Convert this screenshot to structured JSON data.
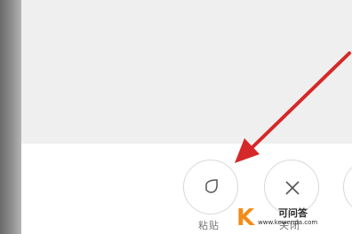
{
  "actions": {
    "paste": {
      "label": "粘贴",
      "icon": "paste-icon"
    },
    "close": {
      "label": "关闭",
      "icon": "close-icon"
    },
    "more": {
      "icon": "more-action-icon"
    }
  },
  "annotation": {
    "arrow_color": "#d62828"
  },
  "watermark": {
    "logo_letter": "K",
    "title": "可问答",
    "url": "www.kewenda.com",
    "accent_color": "#f28c1a"
  }
}
